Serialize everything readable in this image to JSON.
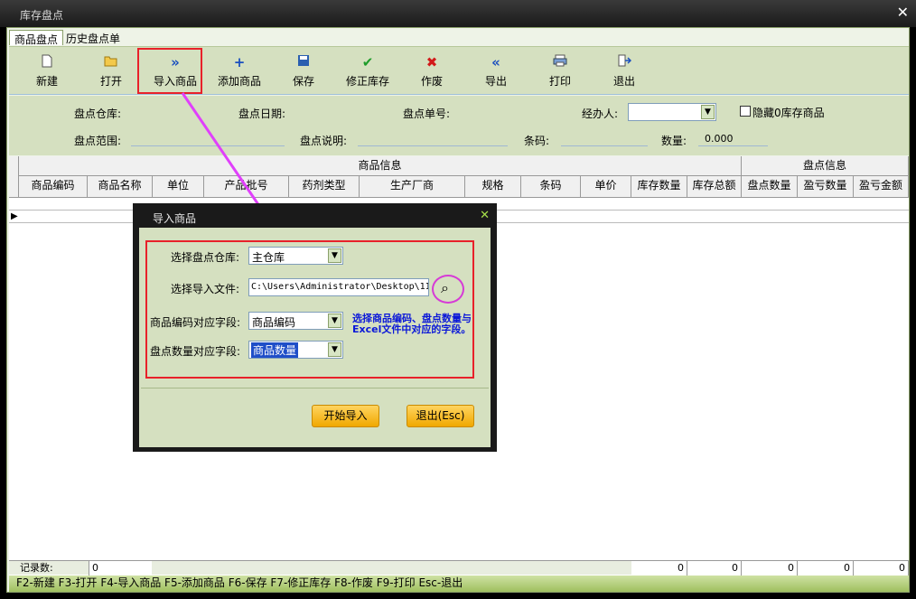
{
  "window": {
    "title": "库存盘点",
    "close": "✕"
  },
  "tabs": [
    {
      "label": "商品盘点"
    },
    {
      "label": "历史盘点单"
    }
  ],
  "toolbar": {
    "new": {
      "label": "新建",
      "icon": "file-icon"
    },
    "open": {
      "label": "打开",
      "icon": "folder-open-icon"
    },
    "import": {
      "label": "导入商品",
      "icon": "double-chevron-right-icon"
    },
    "add": {
      "label": "添加商品",
      "icon": "plus-icon"
    },
    "save": {
      "label": "保存",
      "icon": "disk-icon"
    },
    "fix": {
      "label": "修正库存",
      "icon": "check-icon"
    },
    "void": {
      "label": "作废",
      "icon": "x-icon"
    },
    "export": {
      "label": "导出",
      "icon": "double-chevron-left-icon"
    },
    "print": {
      "label": "打印",
      "icon": "printer-icon"
    },
    "exit": {
      "label": "退出",
      "icon": "exit-door-icon"
    }
  },
  "form": {
    "warehouse_label": "盘点仓库:",
    "date_label": "盘点日期:",
    "number_label": "盘点单号:",
    "handler_label": "经办人:",
    "hide_zero_label": "隐藏0库存商品",
    "range_label": "盘点范围:",
    "desc_label": "盘点说明:",
    "barcode_label": "条码:",
    "qty_label": "数量:",
    "qty_value": "0.000"
  },
  "grid": {
    "group_product": "商品信息",
    "group_count": "盘点信息",
    "columns": [
      "商品编码",
      "商品名称",
      "单位",
      "产品批号",
      "药剂类型",
      "生产厂商",
      "规格",
      "条码",
      "单价",
      "库存数量",
      "库存总额",
      "盘点数量",
      "盈亏数量",
      "盈亏金额"
    ],
    "footer_label": "记录数:",
    "footer_count": "0",
    "footer_totals": [
      "0",
      "0",
      "0",
      "0",
      "0"
    ]
  },
  "status_bar": "F2-新建 F3-打开 F4-导入商品 F5-添加商品 F6-保存 F7-修正库存 F8-作废 F9-打印 Esc-退出",
  "dialog": {
    "title": "导入商品",
    "close": "✕",
    "warehouse_label": "选择盘点仓库:",
    "warehouse_value": "主仓库",
    "file_label": "选择导入文件:",
    "file_value": "C:\\Users\\Administrator\\Desktop\\11",
    "code_field_label": "商品编码对应字段:",
    "code_field_value": "商品编码",
    "qty_field_label": "盘点数量对应字段:",
    "qty_field_value": "商品数量",
    "note": "选择商品编码、盘点数量与Excel文件中对应的字段。",
    "start_button": "开始导入",
    "exit_button": "退出(Esc)"
  },
  "colors": {
    "accent_red": "#e8212a",
    "arrow_magenta": "#e040fb",
    "note_blue": "#0b18d8",
    "panel_green": "#d5e0c0"
  }
}
